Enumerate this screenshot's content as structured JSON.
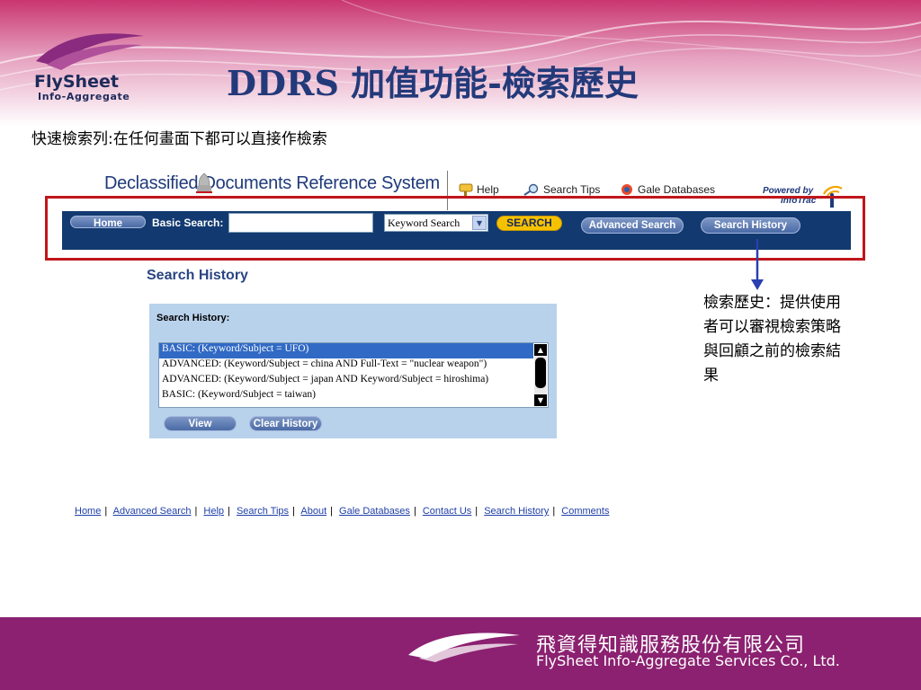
{
  "slide": {
    "logo": {
      "name": "FlySheet",
      "tagline": "Info-Aggregate"
    },
    "title": "DDRS 加值功能-檢索歷史",
    "subtitle": "快速檢索列:在任何畫面下都可以直接作檢索"
  },
  "app": {
    "title": "Declassified Documents Reference System",
    "top_links": [
      {
        "label": "Help",
        "icon": "help-icon"
      },
      {
        "label": "Search Tips",
        "icon": "magnifier-icon"
      },
      {
        "label": "Gale Databases",
        "icon": "gale-icon"
      }
    ],
    "powered_by": {
      "label": "Powered by",
      "brand": "InfoTrac"
    }
  },
  "navbar": {
    "home": "Home",
    "basic_search_label": "Basic Search:",
    "search_value": "",
    "search_type": "Keyword Search",
    "search_button": "SEARCH",
    "advanced_search": "Advanced Search",
    "search_history": "Search History"
  },
  "history": {
    "heading": "Search History",
    "panel_label": "Search History:",
    "items": [
      "BASIC: (Keyword/Subject = UFO)",
      "ADVANCED: (Keyword/Subject = china AND Full-Text = \"nuclear weapon\")",
      "ADVANCED: (Keyword/Subject = japan AND Keyword/Subject = hiroshima)",
      "BASIC: (Keyword/Subject = taiwan)"
    ],
    "selected_index": 0,
    "view_button": "View",
    "clear_button": "Clear History"
  },
  "annotation": "檢索歷史：提供使用者可以審視檢索策略與回顧之前的檢索結果",
  "footer_links": [
    "Home",
    "Advanced Search",
    "Help",
    "Search Tips",
    "About",
    "Gale Databases",
    "Contact Us",
    "Search History",
    "Comments"
  ],
  "company": {
    "name_cn": "飛資得知識服務股份有限公司",
    "name_en": "FlySheet Info-Aggregate Services Co., Ltd."
  },
  "colors": {
    "navbar": "#123a70",
    "highlight": "#c0161b",
    "footer_bar": "#8b2170",
    "title": "#233a7a",
    "search_button": "#f6c200"
  }
}
